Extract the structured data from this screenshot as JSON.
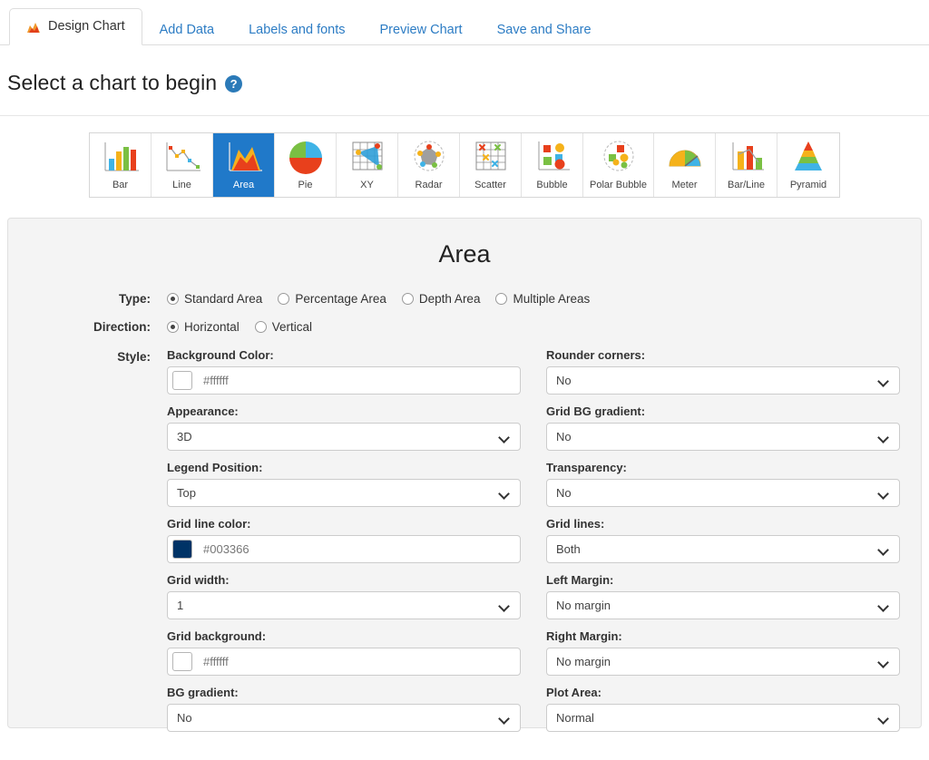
{
  "tabs": [
    {
      "label": "Design Chart",
      "icon": "area-chart-icon",
      "active": true
    },
    {
      "label": "Add Data",
      "icon": "",
      "active": false
    },
    {
      "label": "Labels and fonts",
      "icon": "",
      "active": false
    },
    {
      "label": "Preview Chart",
      "icon": "",
      "active": false
    },
    {
      "label": "Save and Share",
      "icon": "",
      "active": false
    }
  ],
  "header": {
    "title": "Select a chart to begin",
    "help_icon": "help-icon",
    "help_glyph": "?"
  },
  "chart_types": [
    {
      "label": "Bar",
      "selected": false
    },
    {
      "label": "Line",
      "selected": false
    },
    {
      "label": "Area",
      "selected": true
    },
    {
      "label": "Pie",
      "selected": false
    },
    {
      "label": "XY",
      "selected": false
    },
    {
      "label": "Radar",
      "selected": false
    },
    {
      "label": "Scatter",
      "selected": false
    },
    {
      "label": "Bubble",
      "selected": false
    },
    {
      "label": "Polar Bubble",
      "selected": false
    },
    {
      "label": "Meter",
      "selected": false
    },
    {
      "label": "Bar/Line",
      "selected": false
    },
    {
      "label": "Pyramid",
      "selected": false
    }
  ],
  "panel": {
    "title": "Area",
    "type": {
      "label": "Type:",
      "options": [
        {
          "label": "Standard Area",
          "selected": true
        },
        {
          "label": "Percentage Area",
          "selected": false
        },
        {
          "label": "Depth Area",
          "selected": false
        },
        {
          "label": "Multiple Areas",
          "selected": false
        }
      ]
    },
    "direction": {
      "label": "Direction:",
      "options": [
        {
          "label": "Horizontal",
          "selected": true
        },
        {
          "label": "Vertical",
          "selected": false
        }
      ]
    },
    "style": {
      "label": "Style:",
      "left_column": [
        {
          "label": "Background Color:",
          "kind": "color",
          "value": "#ffffff",
          "swatch": "#ffffff"
        },
        {
          "label": "Appearance:",
          "kind": "select",
          "value": "3D"
        },
        {
          "label": "Legend Position:",
          "kind": "select",
          "value": "Top"
        },
        {
          "label": "Grid line color:",
          "kind": "color",
          "value": "#003366",
          "swatch": "#003366"
        },
        {
          "label": "Grid width:",
          "kind": "select",
          "value": "1"
        },
        {
          "label": "Grid background:",
          "kind": "color",
          "value": "#ffffff",
          "swatch": "#ffffff"
        },
        {
          "label": "BG gradient:",
          "kind": "select",
          "value": "No"
        }
      ],
      "right_column": [
        {
          "label": "Rounder corners:",
          "kind": "select",
          "value": "No"
        },
        {
          "label": "Grid BG gradient:",
          "kind": "select",
          "value": "No"
        },
        {
          "label": "Transparency:",
          "kind": "select",
          "value": "No"
        },
        {
          "label": "Grid lines:",
          "kind": "select",
          "value": "Both"
        },
        {
          "label": "Left Margin:",
          "kind": "select",
          "value": "No margin"
        },
        {
          "label": "Right Margin:",
          "kind": "select",
          "value": "No margin"
        },
        {
          "label": "Plot Area:",
          "kind": "select",
          "value": "Normal"
        }
      ]
    }
  },
  "colors": {
    "accent_blue": "#2c7cc4",
    "selected_tile": "#2079c9",
    "panel_bg": "#f4f4f4",
    "grid_line_color": "#003366"
  }
}
